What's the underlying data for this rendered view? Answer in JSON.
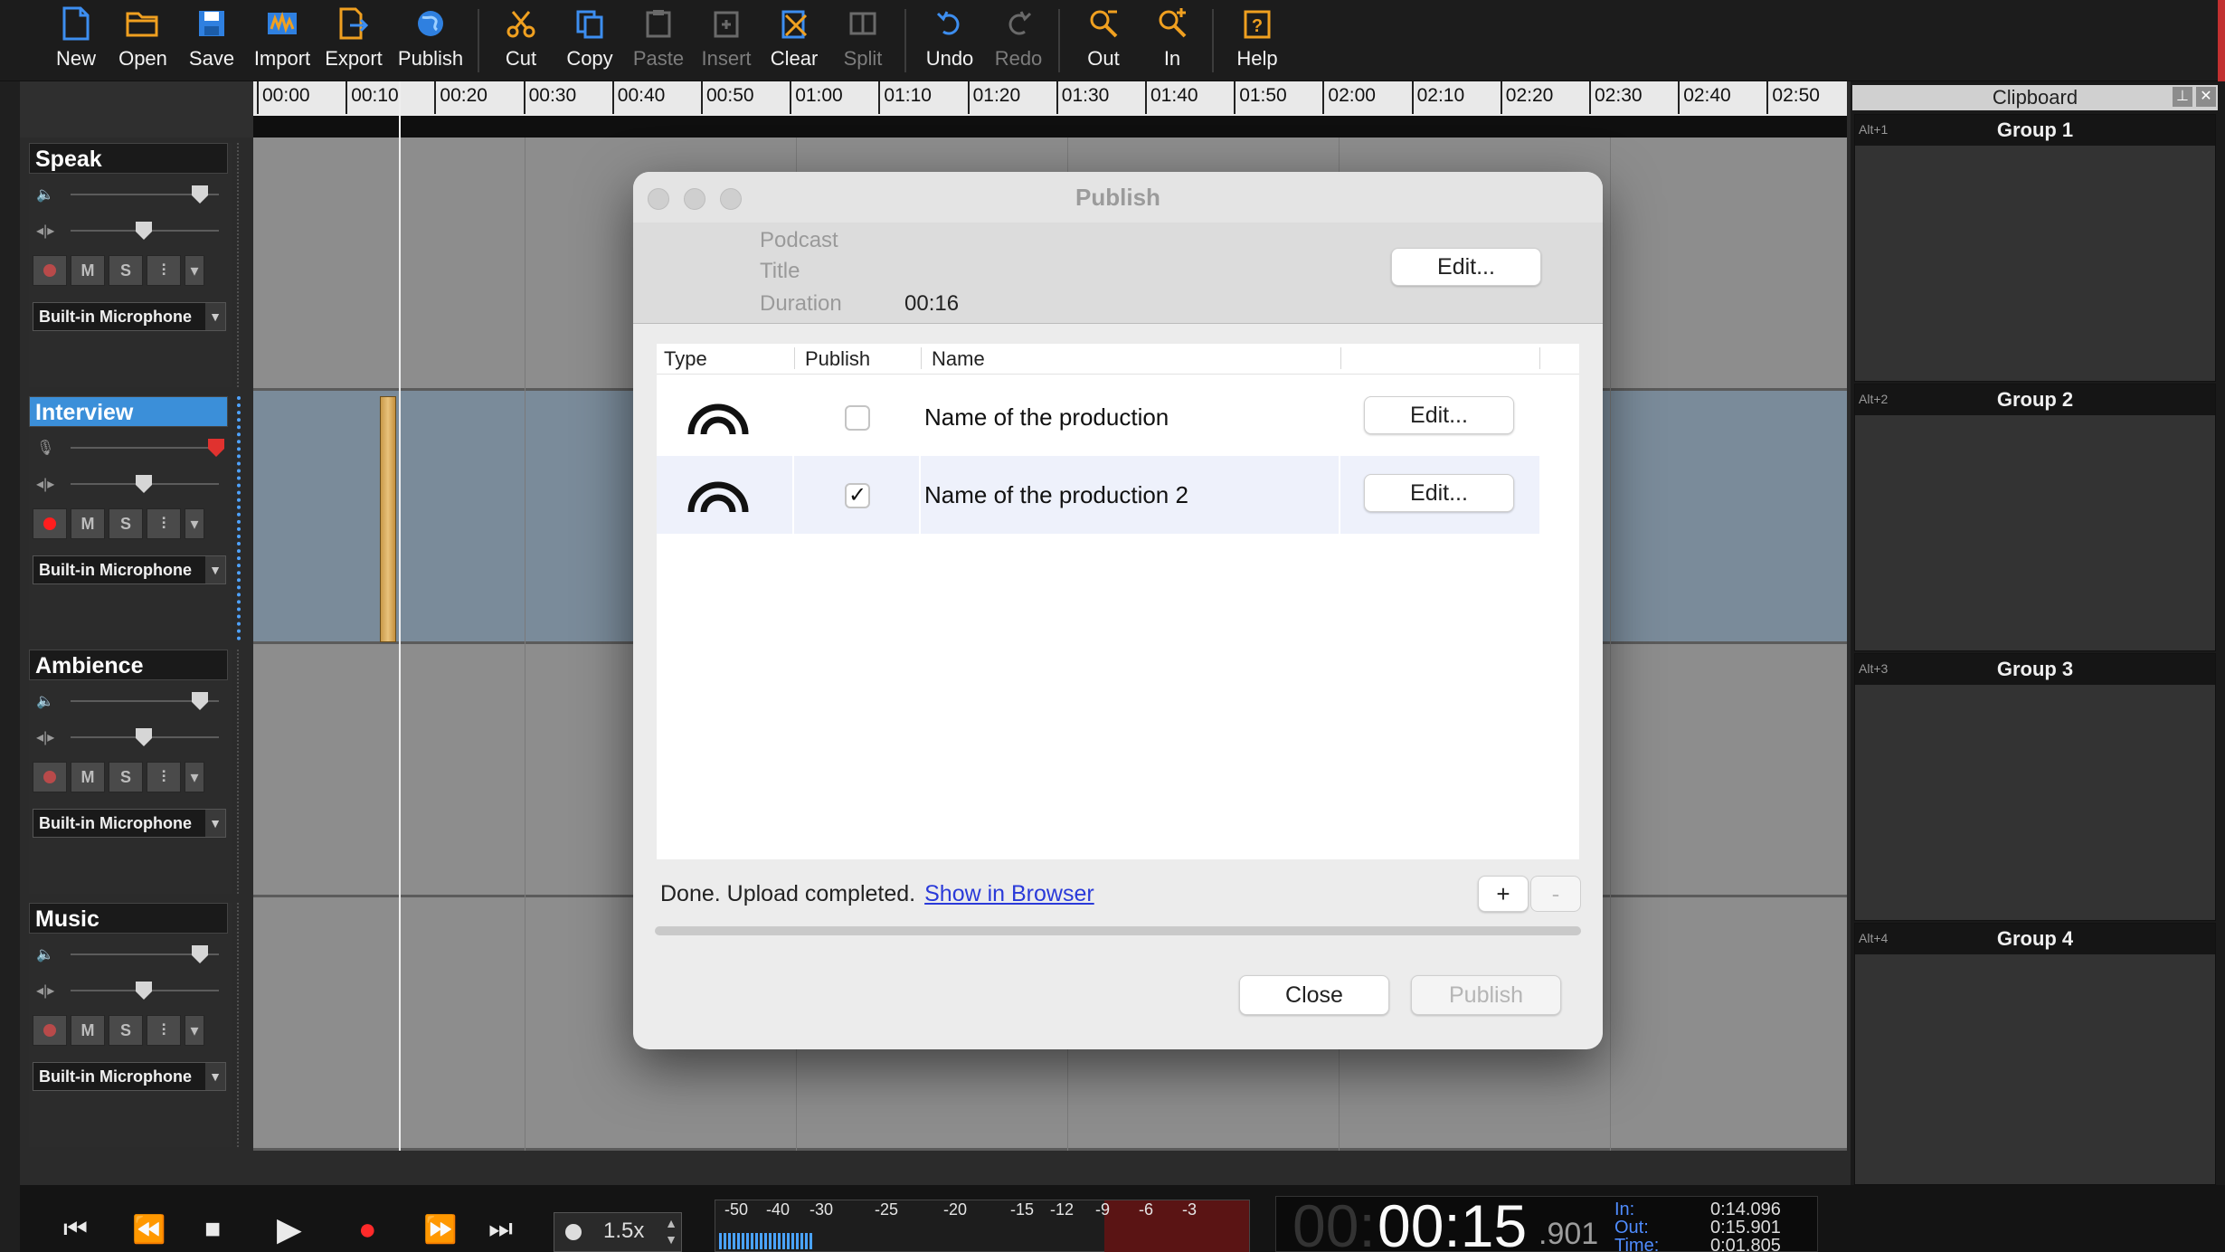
{
  "toolbar": {
    "items": [
      {
        "label": "New",
        "icon": "new-file-icon",
        "enabled": true
      },
      {
        "label": "Open",
        "icon": "open-folder-icon",
        "enabled": true
      },
      {
        "label": "Save",
        "icon": "save-disk-icon",
        "enabled": true
      },
      {
        "label": "Import",
        "icon": "import-icon",
        "enabled": true
      },
      {
        "label": "Export",
        "icon": "export-icon",
        "enabled": true
      },
      {
        "label": "Publish",
        "icon": "globe-icon",
        "enabled": true
      },
      {
        "label": "Cut",
        "icon": "scissors-icon",
        "enabled": true
      },
      {
        "label": "Copy",
        "icon": "copy-icon",
        "enabled": true
      },
      {
        "label": "Paste",
        "icon": "paste-icon",
        "enabled": false
      },
      {
        "label": "Insert",
        "icon": "insert-icon",
        "enabled": false
      },
      {
        "label": "Clear",
        "icon": "clear-icon",
        "enabled": true
      },
      {
        "label": "Split",
        "icon": "split-icon",
        "enabled": false
      },
      {
        "label": "Undo",
        "icon": "undo-icon",
        "enabled": true
      },
      {
        "label": "Redo",
        "icon": "redo-icon",
        "enabled": false
      },
      {
        "label": "Out",
        "icon": "zoom-out-icon",
        "enabled": true
      },
      {
        "label": "In",
        "icon": "zoom-in-icon",
        "enabled": true
      },
      {
        "label": "Help",
        "icon": "help-icon",
        "enabled": true
      }
    ]
  },
  "ruler": {
    "labels": [
      "00:00",
      "00:10",
      "00:20",
      "00:30",
      "00:40",
      "00:50",
      "01:00",
      "01:10",
      "01:20",
      "01:30",
      "01:40",
      "01:50",
      "02:00",
      "02:10",
      "02:20",
      "02:30",
      "02:40",
      "02:50"
    ]
  },
  "tracks": [
    {
      "name": "Speak",
      "input": "Built-in Microphone",
      "selected": false,
      "armed": false
    },
    {
      "name": "Interview",
      "input": "Built-in Microphone",
      "selected": true,
      "armed": true
    },
    {
      "name": "Ambience",
      "input": "Built-in Microphone",
      "selected": false,
      "armed": false
    },
    {
      "name": "Music",
      "input": "Built-in Microphone",
      "selected": false,
      "armed": false
    }
  ],
  "track_buttons": {
    "mute": "M",
    "solo": "S"
  },
  "clipboard": {
    "title": "Clipboard",
    "groups": [
      {
        "shortcut": "Alt+1",
        "name": "Group 1"
      },
      {
        "shortcut": "Alt+2",
        "name": "Group 2"
      },
      {
        "shortcut": "Alt+3",
        "name": "Group 3"
      },
      {
        "shortcut": "Alt+4",
        "name": "Group 4"
      }
    ]
  },
  "transport": {
    "speed": "1.5x",
    "meter_labels": [
      "-50",
      "-40",
      "-30",
      "-25",
      "-20",
      "-15",
      "-12",
      "-9",
      "-6",
      "-3"
    ],
    "clock_dim": "00:",
    "clock_main": "00:15",
    "clock_ms": ".901",
    "in_label": "In:",
    "out_label": "Out:",
    "time_label": "Time:",
    "in_value": "0:14.096",
    "out_value": "0:15.901",
    "time_value": "0:01.805"
  },
  "dialog": {
    "title": "Publish",
    "meta": {
      "podcast_label": "Podcast",
      "title_label": "Title",
      "duration_label": "Duration",
      "duration_value": "00:16",
      "edit_label": "Edit..."
    },
    "columns": {
      "type": "Type",
      "publish": "Publish",
      "name": "Name"
    },
    "rows": [
      {
        "name": "Name of the production",
        "publish": false,
        "edit": "Edit...",
        "type_icon": "broadcast-arc-icon"
      },
      {
        "name": "Name of the production 2",
        "publish": true,
        "edit": "Edit...",
        "type_icon": "broadcast-arc-icon"
      }
    ],
    "add_label": "+",
    "remove_label": "-",
    "status_text": "Done.  Upload completed.",
    "status_link": "Show in Browser",
    "close_label": "Close",
    "publish_label": "Publish"
  }
}
